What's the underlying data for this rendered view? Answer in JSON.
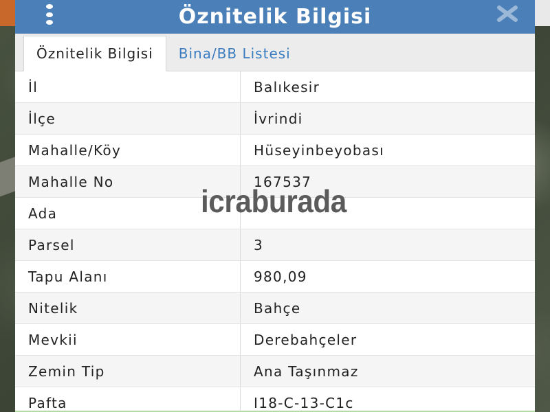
{
  "dialog": {
    "title": "Öznitelik Bilgisi",
    "tabs": [
      {
        "label": "Öznitelik Bilgisi",
        "active": true
      },
      {
        "label": "Bina/BB Listesi",
        "active": false
      }
    ]
  },
  "attributes": [
    {
      "key": "İl",
      "value": "Balıkesir"
    },
    {
      "key": "İlçe",
      "value": "İvrindi"
    },
    {
      "key": "Mahalle/Köy",
      "value": "Hüseyinbeyobası"
    },
    {
      "key": "Mahalle No",
      "value": "167537"
    },
    {
      "key": "Ada",
      "value": ""
    },
    {
      "key": "Parsel",
      "value": "3"
    },
    {
      "key": "Tapu Alanı",
      "value": "980,09"
    },
    {
      "key": "Nitelik",
      "value": "Bahçe"
    },
    {
      "key": "Mevkii",
      "value": "Derebahçeler"
    },
    {
      "key": "Zemin Tip",
      "value": "Ana Taşınmaz"
    },
    {
      "key": "Pafta",
      "value": "I18-C-13-C1c"
    }
  ],
  "watermark": "icraburada",
  "icons": {
    "menu": "vertical-dots-icon",
    "close": "close-icon"
  },
  "colors": {
    "titlebar": "#4a7fb8",
    "tab_active_text": "#222222",
    "tab_inactive_text": "#3a7cc0"
  }
}
